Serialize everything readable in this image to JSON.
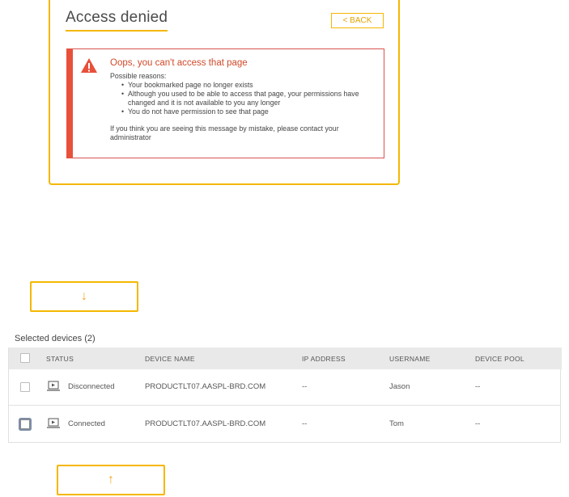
{
  "card": {
    "title": "Access denied",
    "back_label": "< BACK",
    "alert": {
      "heading": "Oops, you can't access that page",
      "intro": "Possible reasons:",
      "reasons": [
        "Your bookmarked page no longer exists",
        "Although you used to be able to access that page, your permissions have changed and it is not available to you any longer",
        "You do not have permission to see that page"
      ],
      "footer": "If you think you are seeing this message by mistake, please contact your administrator",
      "icon": "warning-icon"
    }
  },
  "controls": {
    "down_arrow": "↓",
    "up_arrow": "↑"
  },
  "devices": {
    "label": "Selected devices (2)",
    "columns": [
      "STATUS",
      "DEVICE NAME",
      "IP ADDRESS",
      "USERNAME",
      "DEVICE POOL"
    ],
    "rows": [
      {
        "status": "Disconnected",
        "device_name": "PRODUCTLT07.AASPL-BRD.COM",
        "ip": "--",
        "username": "Jason",
        "pool": "--",
        "icon": "device-icon"
      },
      {
        "status": "Connected",
        "device_name": "PRODUCTLT07.AASPL-BRD.COM",
        "ip": "--",
        "username": "Tom",
        "pool": "--",
        "icon": "device-icon"
      }
    ]
  },
  "colors": {
    "accent": "#f5b700",
    "error": "#e8503a"
  }
}
